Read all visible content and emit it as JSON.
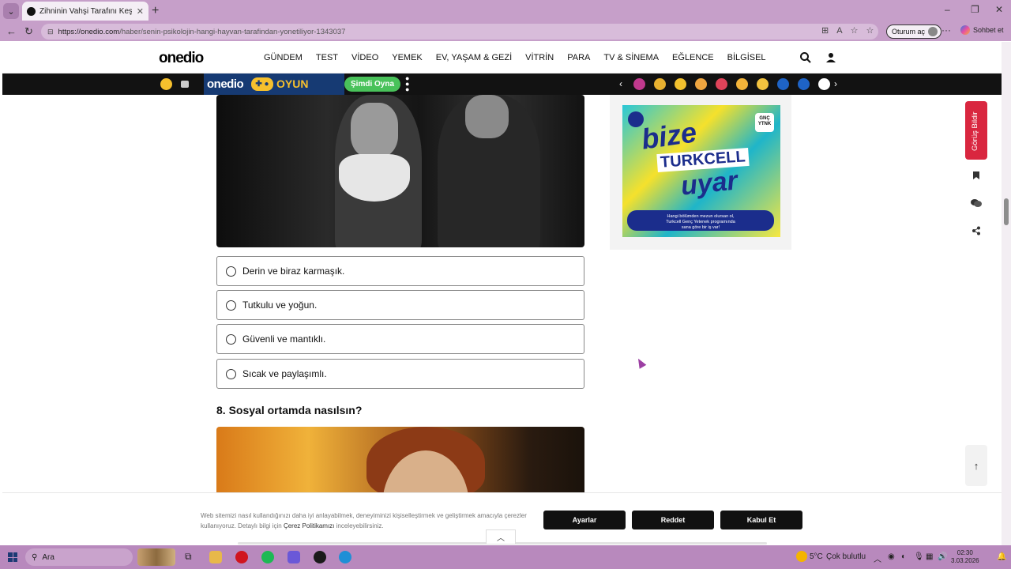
{
  "browser": {
    "tab_title": "Zihninin Vahşi Tarafını Keşfet! - On",
    "url_domain": "https://onedio.com",
    "url_path": "/haber/senin-psikolojin-hangi-hayvan-tarafindan-yonetiliyor-1343037",
    "signin_label": "Oturum aç",
    "copilot_label": "Sohbet et"
  },
  "site": {
    "logo": "onedio",
    "nav": [
      "GÜNDEM",
      "TEST",
      "VİDEO",
      "YEMEK",
      "EV, YAŞAM & GEZİ",
      "VİTRİN",
      "PARA",
      "TV & SİNEMA",
      "EĞLENCE",
      "BİLGİSEL"
    ]
  },
  "gamebar": {
    "logo": "onedio",
    "oyun": "OYUN",
    "play_label": "Şimdi Oyna",
    "emoji_colors": [
      "#c0398d",
      "#e8b130",
      "#f2c12e",
      "#f0a640",
      "#e0435a",
      "#f3b43a",
      "#f3c33f",
      "#1e63c6",
      "#1e63c6",
      "#ffffff"
    ]
  },
  "quiz": {
    "answers": [
      "Derin ve biraz karmaşık.",
      "Tutkulu ve yoğun.",
      "Güvenli ve mantıklı.",
      "Sıcak ve paylaşımlı."
    ],
    "next_question": "8. Sosyal ortamda nasılsın?"
  },
  "ad": {
    "line1": "bize",
    "line2": "TURKCELL",
    "line3": "uyar",
    "badge": "GNÇ YTNK",
    "footer_line1": "Hangi bölümden mezun olursan ol,",
    "footer_line2": "Turkcell Genç Yetenek programında",
    "footer_line3": "sana göre bir iş var!"
  },
  "sidebar": {
    "feedback_label": "Görüş Bildir"
  },
  "cookie": {
    "text_before": "Web sitemizi nasıl kullandığınızı daha iyi anlayabilmek, deneyiminizi kişiselleştirmek ve geliştirmek amacıyla çerezler kullanıyoruz. Detaylı bilgi için ",
    "policy_link": "Çerez Politikamızı",
    "text_after": " inceleyebilirsiniz.",
    "settings_label": "Ayarlar",
    "reject_label": "Reddet",
    "accept_label": "Kabul Et"
  },
  "taskbar": {
    "search_placeholder": "Ara",
    "weather_temp": "5°C",
    "weather_text": "Çok bulutlu",
    "time": "02:30",
    "date": "3.03.2026"
  }
}
